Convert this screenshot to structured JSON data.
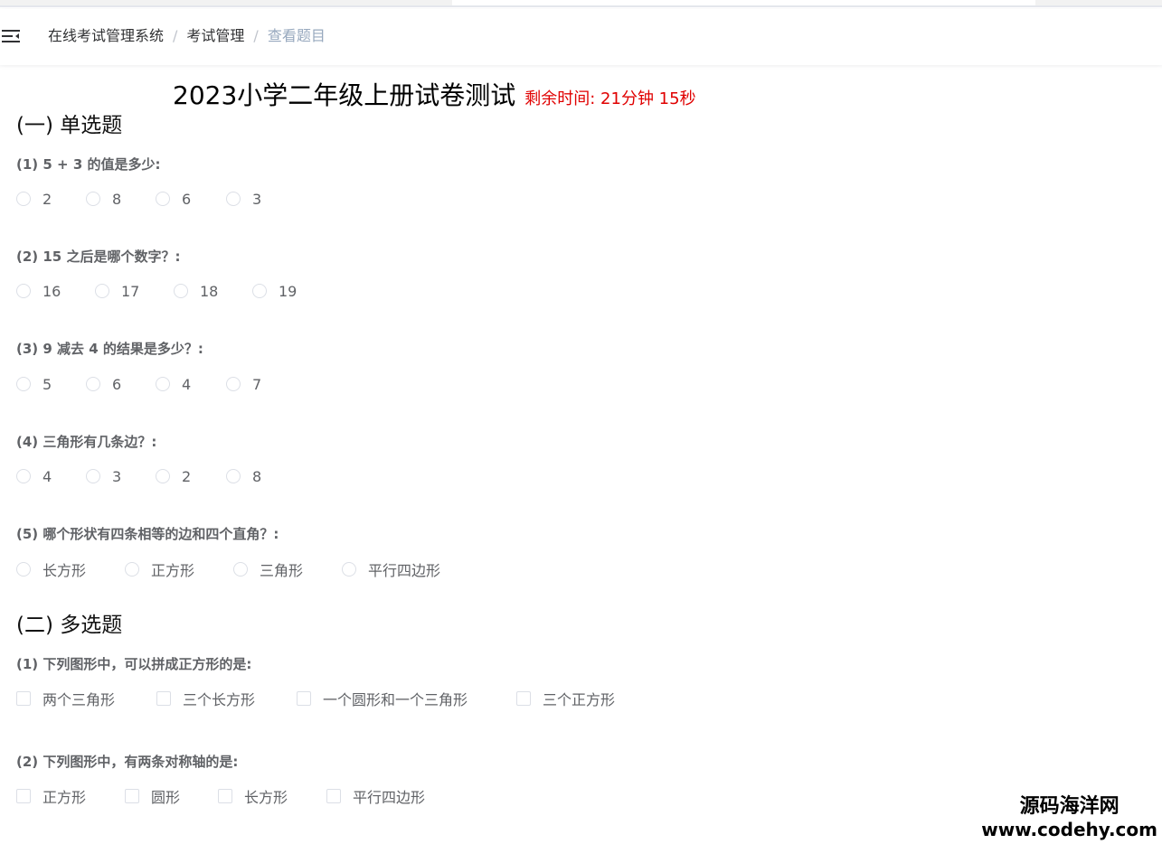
{
  "breadcrumb": [
    "在线考试管理系统",
    "考试管理",
    "查看题目"
  ],
  "exam": {
    "title": "2023小学二年级上册试卷测试",
    "timer": "剩余时间: 21分钟 15秒"
  },
  "single_section": {
    "title": "(一) 单选题",
    "questions": [
      {
        "label": "(1) 5 + 3 的值是多少:",
        "options": [
          "2",
          "8",
          "6",
          "3"
        ]
      },
      {
        "label": "(2) 15 之后是哪个数字？:",
        "options": [
          "16",
          "17",
          "18",
          "19"
        ]
      },
      {
        "label": "(3) 9 减去 4 的结果是多少？:",
        "options": [
          "5",
          "6",
          "4",
          "7"
        ]
      },
      {
        "label": "(4) 三角形有几条边？:",
        "options": [
          "4",
          "3",
          "2",
          "8"
        ]
      },
      {
        "label": "(5) 哪个形状有四条相等的边和四个直角？:",
        "options": [
          "长方形",
          "正方形",
          "三角形",
          "平行四边形"
        ]
      }
    ]
  },
  "multi_section": {
    "title": "(二) 多选题",
    "questions": [
      {
        "label": "(1) 下列图形中，可以拼成正方形的是:",
        "options": [
          "两个三角形",
          "三个长方形",
          "一个圆形和一个三角形",
          "三个正方形"
        ]
      },
      {
        "label": "(2) 下列图形中，有两条对称轴的是:",
        "options": [
          "正方形",
          "圆形",
          "长方形",
          "平行四边形"
        ]
      }
    ]
  },
  "watermark": {
    "name": "源码海洋网",
    "url": "www.codehy.com"
  }
}
